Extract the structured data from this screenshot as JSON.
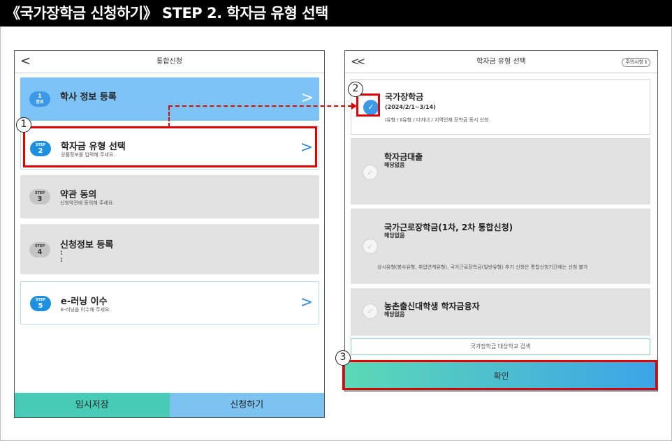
{
  "page_title": "《국가장학금 신청하기》 STEP 2. 학자금 유형 선택",
  "left": {
    "header": "통합신청",
    "steps": [
      {
        "step": "1",
        "step_label": "완료",
        "title": "학사 정보 등록",
        "sub": ""
      },
      {
        "step": "2",
        "step_label": "STEP",
        "title": "학자금 유형 선택",
        "sub": "상품정보를 입력해 주세요."
      },
      {
        "step": "3",
        "step_label": "STEP",
        "title": "약관 동의",
        "sub": "신청약관에 동의해 주세요."
      },
      {
        "step": "4",
        "step_label": "STEP",
        "title": "신청정보 등록",
        "sub": ":"
      },
      {
        "step": "5",
        "step_label": "STEP",
        "title": "e-러닝 이수",
        "sub": "E-러닝을 이수해 주세요."
      }
    ],
    "save_button": "임시저장",
    "apply_button": "신청하기"
  },
  "right": {
    "header": "학자금 유형 선택",
    "notice_button": "주의사항 ℹ",
    "types": [
      {
        "title": "국가장학금",
        "sub": "(2024/2/1~3/14)",
        "note": "Ⅰ유형 / Ⅱ유형 / 다자녀 / 지역인재 장학금 동시 신청",
        "checked": true
      },
      {
        "title": "학자금대출",
        "sub": "해당없음",
        "note": "",
        "checked": false
      },
      {
        "title": "국가근로장학금(1차, 2차 통합신청)",
        "sub": "해당없음",
        "note": "상시유형(봉사유형, 취업연계유형), 국가근로장학금(일반유형) 추가 신청은 통합신청기간에는 신청 불가",
        "checked": false
      },
      {
        "title": "농촌출신대학생 학자금융자",
        "sub": "해당없음",
        "note": "",
        "checked": false
      }
    ],
    "search_button": "국가장학금 대상학교 검색",
    "confirm_button": "확인"
  },
  "annotations": {
    "one": "1",
    "two": "2",
    "three": "3"
  },
  "colors": {
    "annotation_red": "#e00000",
    "step_blue": "#1f8fe0",
    "done_card": "#7ec3f5",
    "save_green": "#46cbb6",
    "apply_blue": "#7cc3f2"
  }
}
